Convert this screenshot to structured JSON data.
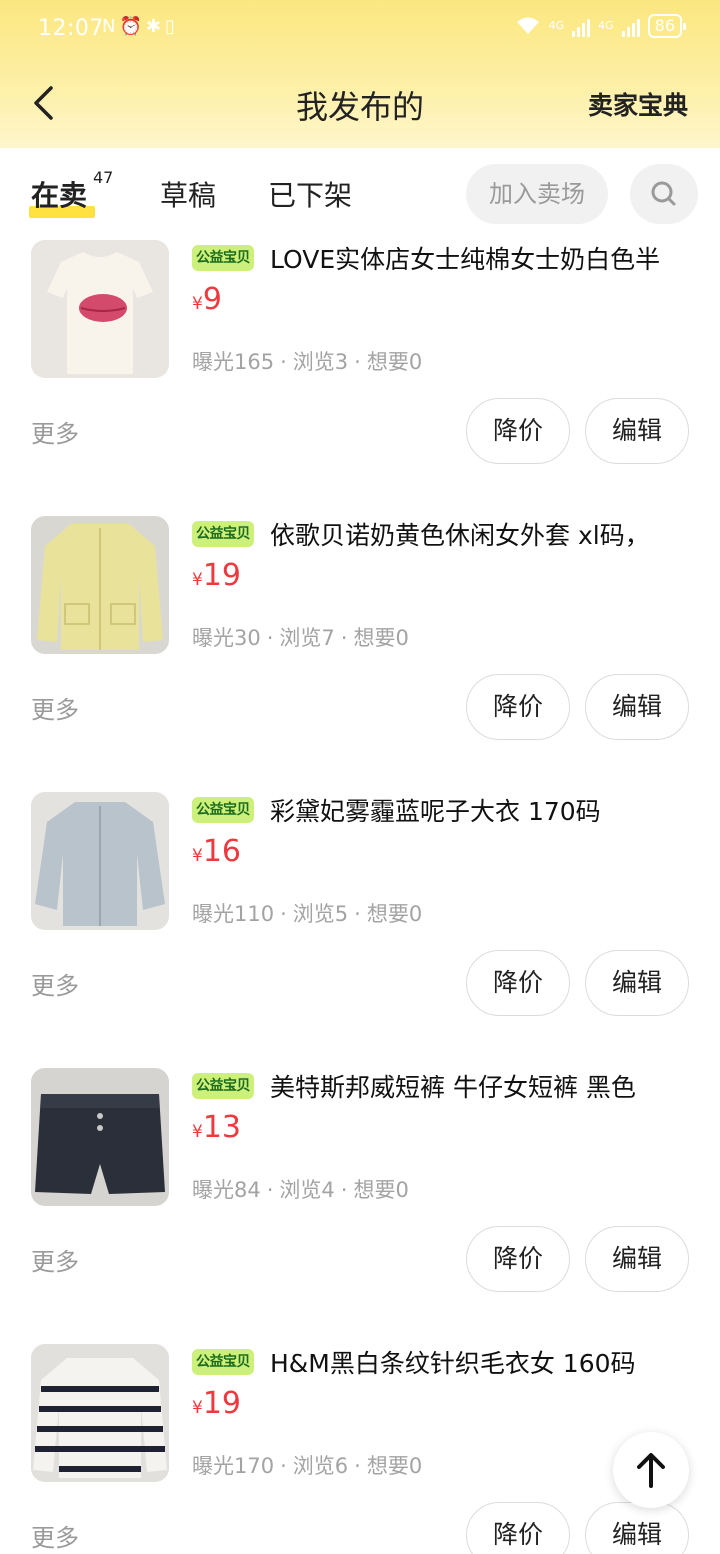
{
  "status_bar": {
    "time": "12:07",
    "left_icons": [
      "N",
      "⏰",
      "✱",
      "▯"
    ],
    "network_1": "4G",
    "network_2": "4G",
    "battery": "86"
  },
  "nav": {
    "title": "我发布的",
    "right_link": "卖家宝典"
  },
  "tabs": {
    "items": [
      {
        "label": "在卖",
        "count": "47",
        "active": true
      },
      {
        "label": "草稿"
      },
      {
        "label": "已下架"
      }
    ],
    "join_button": "加入卖场"
  },
  "colors": {
    "header_yellow": "#fbe77f",
    "accent_yellow": "#ffe23f",
    "price_red": "#f0393e",
    "badge_green": "#cdf07b"
  },
  "items": [
    {
      "badge": "公益宝贝",
      "title": "LOVE实体店女士纯棉女士奶白色半",
      "currency": "¥",
      "price": "9",
      "stats": [
        "曝光165",
        "浏览3",
        "想要0"
      ],
      "more": "更多",
      "lower_price": "降价",
      "edit": "编辑",
      "thumb": "white-tshirt-red-lips"
    },
    {
      "badge": "公益宝贝",
      "title": "依歌贝诺奶黄色休闲女外套 xl码，",
      "currency": "¥",
      "price": "19",
      "stats": [
        "曝光30",
        "浏览7",
        "想要0"
      ],
      "more": "更多",
      "lower_price": "降价",
      "edit": "编辑",
      "thumb": "yellow-jacket"
    },
    {
      "badge": "公益宝贝",
      "title": "彩黛妃雾霾蓝呢子大衣 170码",
      "currency": "¥",
      "price": "16",
      "stats": [
        "曝光110",
        "浏览5",
        "想要0"
      ],
      "more": "更多",
      "lower_price": "降价",
      "edit": "编辑",
      "thumb": "grey-blue-coat"
    },
    {
      "badge": "公益宝贝",
      "title": "美特斯邦威短裤 牛仔女短裤 黑色",
      "currency": "¥",
      "price": "13",
      "stats": [
        "曝光84",
        "浏览4",
        "想要0"
      ],
      "more": "更多",
      "lower_price": "降价",
      "edit": "编辑",
      "thumb": "denim-shorts"
    },
    {
      "badge": "公益宝贝",
      "title": "H&M黑白条纹针织毛衣女 160码",
      "currency": "¥",
      "price": "19",
      "stats": [
        "曝光170",
        "浏览6",
        "想要0"
      ],
      "more": "更多",
      "lower_price": "降价",
      "edit": "编辑",
      "thumb": "striped-sweater"
    }
  ]
}
